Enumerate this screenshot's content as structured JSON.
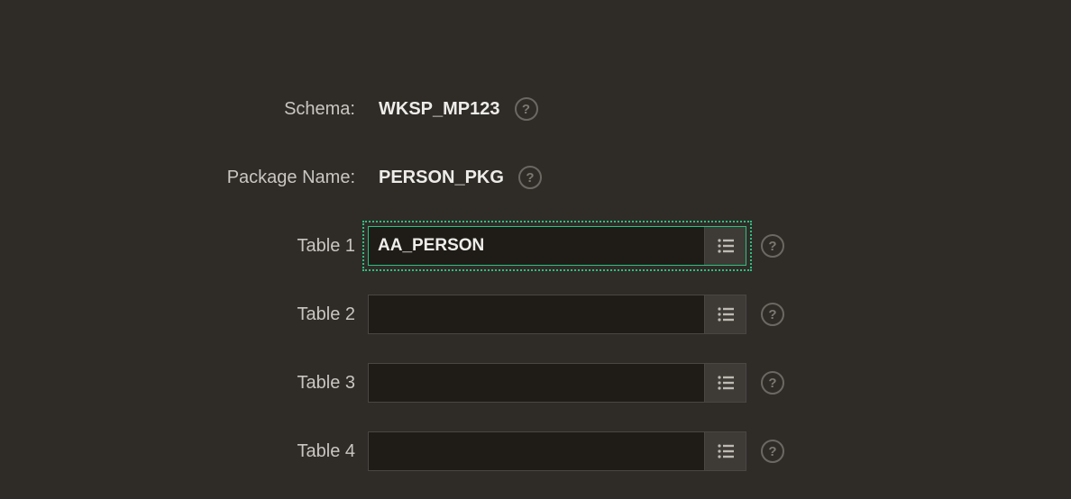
{
  "colors": {
    "accent": "#2fbf7f",
    "bg": "#2f2c28",
    "inputBg": "#1f1c18"
  },
  "help_glyph": "?",
  "fields": {
    "schema": {
      "label": "Schema:",
      "value": "WKSP_MP123"
    },
    "package": {
      "label": "Package Name:",
      "value": "PERSON_PKG"
    }
  },
  "tables": [
    {
      "label": "Table 1",
      "value": "AA_PERSON",
      "focused": true
    },
    {
      "label": "Table 2",
      "value": "",
      "focused": false
    },
    {
      "label": "Table 3",
      "value": "",
      "focused": false
    },
    {
      "label": "Table 4",
      "value": "",
      "focused": false
    }
  ]
}
